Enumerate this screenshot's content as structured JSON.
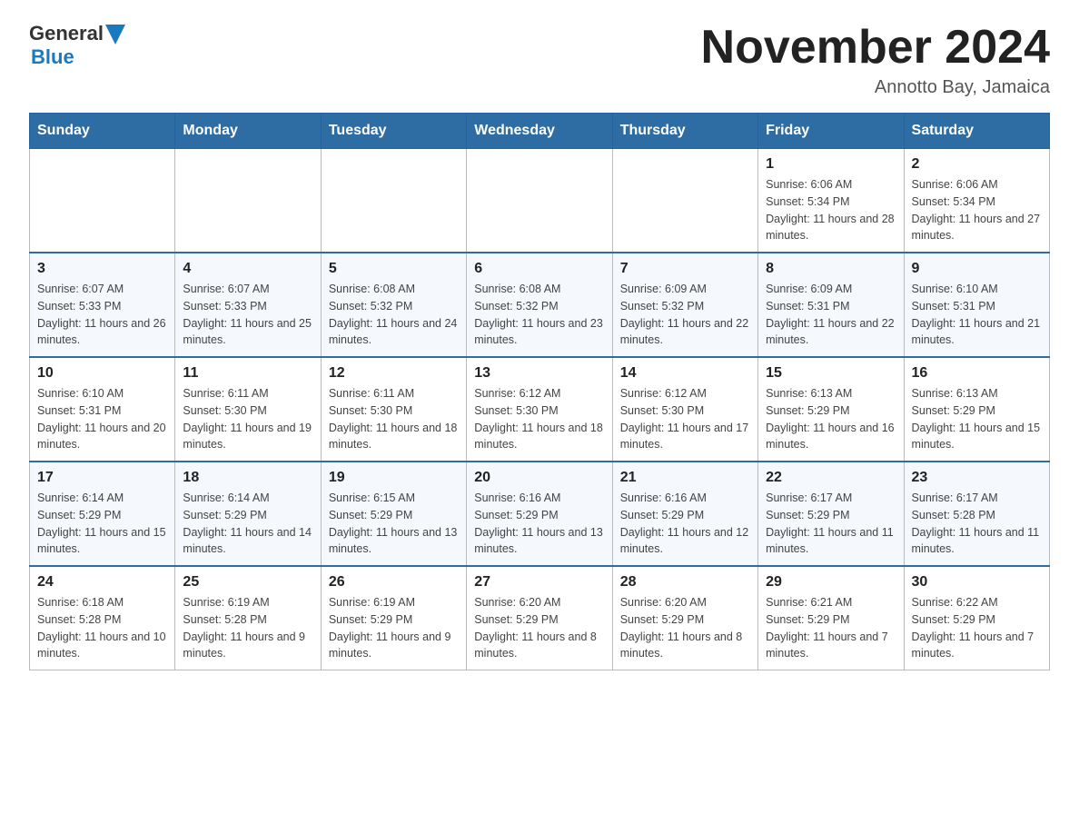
{
  "header": {
    "logo_general": "General",
    "logo_blue": "Blue",
    "title": "November 2024",
    "subtitle": "Annotto Bay, Jamaica"
  },
  "days_of_week": [
    "Sunday",
    "Monday",
    "Tuesday",
    "Wednesday",
    "Thursday",
    "Friday",
    "Saturday"
  ],
  "weeks": [
    [
      {
        "day": "",
        "info": ""
      },
      {
        "day": "",
        "info": ""
      },
      {
        "day": "",
        "info": ""
      },
      {
        "day": "",
        "info": ""
      },
      {
        "day": "",
        "info": ""
      },
      {
        "day": "1",
        "info": "Sunrise: 6:06 AM\nSunset: 5:34 PM\nDaylight: 11 hours and 28 minutes."
      },
      {
        "day": "2",
        "info": "Sunrise: 6:06 AM\nSunset: 5:34 PM\nDaylight: 11 hours and 27 minutes."
      }
    ],
    [
      {
        "day": "3",
        "info": "Sunrise: 6:07 AM\nSunset: 5:33 PM\nDaylight: 11 hours and 26 minutes."
      },
      {
        "day": "4",
        "info": "Sunrise: 6:07 AM\nSunset: 5:33 PM\nDaylight: 11 hours and 25 minutes."
      },
      {
        "day": "5",
        "info": "Sunrise: 6:08 AM\nSunset: 5:32 PM\nDaylight: 11 hours and 24 minutes."
      },
      {
        "day": "6",
        "info": "Sunrise: 6:08 AM\nSunset: 5:32 PM\nDaylight: 11 hours and 23 minutes."
      },
      {
        "day": "7",
        "info": "Sunrise: 6:09 AM\nSunset: 5:32 PM\nDaylight: 11 hours and 22 minutes."
      },
      {
        "day": "8",
        "info": "Sunrise: 6:09 AM\nSunset: 5:31 PM\nDaylight: 11 hours and 22 minutes."
      },
      {
        "day": "9",
        "info": "Sunrise: 6:10 AM\nSunset: 5:31 PM\nDaylight: 11 hours and 21 minutes."
      }
    ],
    [
      {
        "day": "10",
        "info": "Sunrise: 6:10 AM\nSunset: 5:31 PM\nDaylight: 11 hours and 20 minutes."
      },
      {
        "day": "11",
        "info": "Sunrise: 6:11 AM\nSunset: 5:30 PM\nDaylight: 11 hours and 19 minutes."
      },
      {
        "day": "12",
        "info": "Sunrise: 6:11 AM\nSunset: 5:30 PM\nDaylight: 11 hours and 18 minutes."
      },
      {
        "day": "13",
        "info": "Sunrise: 6:12 AM\nSunset: 5:30 PM\nDaylight: 11 hours and 18 minutes."
      },
      {
        "day": "14",
        "info": "Sunrise: 6:12 AM\nSunset: 5:30 PM\nDaylight: 11 hours and 17 minutes."
      },
      {
        "day": "15",
        "info": "Sunrise: 6:13 AM\nSunset: 5:29 PM\nDaylight: 11 hours and 16 minutes."
      },
      {
        "day": "16",
        "info": "Sunrise: 6:13 AM\nSunset: 5:29 PM\nDaylight: 11 hours and 15 minutes."
      }
    ],
    [
      {
        "day": "17",
        "info": "Sunrise: 6:14 AM\nSunset: 5:29 PM\nDaylight: 11 hours and 15 minutes."
      },
      {
        "day": "18",
        "info": "Sunrise: 6:14 AM\nSunset: 5:29 PM\nDaylight: 11 hours and 14 minutes."
      },
      {
        "day": "19",
        "info": "Sunrise: 6:15 AM\nSunset: 5:29 PM\nDaylight: 11 hours and 13 minutes."
      },
      {
        "day": "20",
        "info": "Sunrise: 6:16 AM\nSunset: 5:29 PM\nDaylight: 11 hours and 13 minutes."
      },
      {
        "day": "21",
        "info": "Sunrise: 6:16 AM\nSunset: 5:29 PM\nDaylight: 11 hours and 12 minutes."
      },
      {
        "day": "22",
        "info": "Sunrise: 6:17 AM\nSunset: 5:29 PM\nDaylight: 11 hours and 11 minutes."
      },
      {
        "day": "23",
        "info": "Sunrise: 6:17 AM\nSunset: 5:28 PM\nDaylight: 11 hours and 11 minutes."
      }
    ],
    [
      {
        "day": "24",
        "info": "Sunrise: 6:18 AM\nSunset: 5:28 PM\nDaylight: 11 hours and 10 minutes."
      },
      {
        "day": "25",
        "info": "Sunrise: 6:19 AM\nSunset: 5:28 PM\nDaylight: 11 hours and 9 minutes."
      },
      {
        "day": "26",
        "info": "Sunrise: 6:19 AM\nSunset: 5:29 PM\nDaylight: 11 hours and 9 minutes."
      },
      {
        "day": "27",
        "info": "Sunrise: 6:20 AM\nSunset: 5:29 PM\nDaylight: 11 hours and 8 minutes."
      },
      {
        "day": "28",
        "info": "Sunrise: 6:20 AM\nSunset: 5:29 PM\nDaylight: 11 hours and 8 minutes."
      },
      {
        "day": "29",
        "info": "Sunrise: 6:21 AM\nSunset: 5:29 PM\nDaylight: 11 hours and 7 minutes."
      },
      {
        "day": "30",
        "info": "Sunrise: 6:22 AM\nSunset: 5:29 PM\nDaylight: 11 hours and 7 minutes."
      }
    ]
  ]
}
